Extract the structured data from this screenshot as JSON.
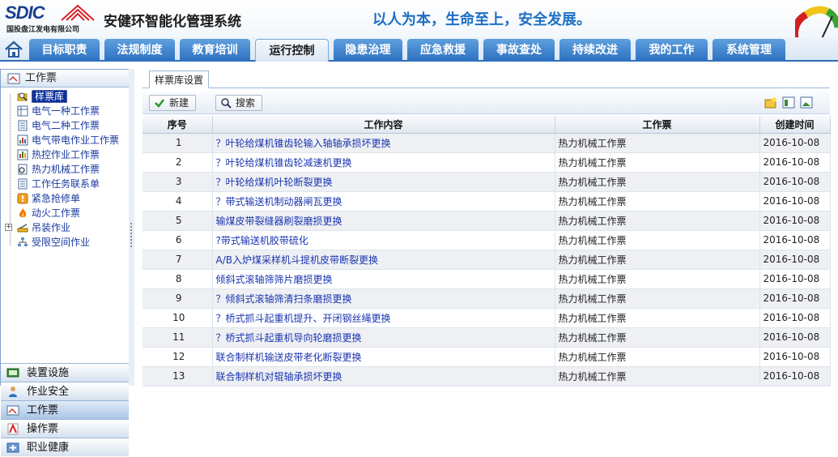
{
  "header": {
    "logo_text": "SDIC",
    "company": "国投盘江发电有限公司",
    "system_title": "安健环智能化管理系统",
    "slogan": "以人为本，生命至上，安全发展。"
  },
  "nav": {
    "tabs": [
      {
        "label": "目标职责",
        "active": false
      },
      {
        "label": "法规制度",
        "active": false
      },
      {
        "label": "教育培训",
        "active": false
      },
      {
        "label": "运行控制",
        "active": true
      },
      {
        "label": "隐患治理",
        "active": false
      },
      {
        "label": "应急救援",
        "active": false
      },
      {
        "label": "事故查处",
        "active": false
      },
      {
        "label": "持续改进",
        "active": false
      },
      {
        "label": "我的工作",
        "active": false
      },
      {
        "label": "系统管理",
        "active": false
      }
    ]
  },
  "sidebar": {
    "title": "工作票",
    "tree": [
      {
        "label": "样票库",
        "icon": "search-folder-icon",
        "selected": true
      },
      {
        "label": "电气一种工作票",
        "icon": "document-grid-icon"
      },
      {
        "label": "电气二种工作票",
        "icon": "document-list-icon"
      },
      {
        "label": "电气带电作业工作票",
        "icon": "document-chart-icon"
      },
      {
        "label": "热控作业工作票",
        "icon": "document-chart-icon"
      },
      {
        "label": "热力机械工作票",
        "icon": "gear-document-icon"
      },
      {
        "label": "工作任务联系单",
        "icon": "document-list-icon"
      },
      {
        "label": "紧急抢修单",
        "icon": "warning-icon"
      },
      {
        "label": "动火工作票",
        "icon": "fire-icon"
      },
      {
        "label": "吊装作业",
        "icon": "crane-icon",
        "expandable": true
      },
      {
        "label": "受限空间作业",
        "icon": "network-icon"
      }
    ],
    "accordion": [
      {
        "label": "装置设施",
        "icon": "device-icon",
        "active": false
      },
      {
        "label": "作业安全",
        "icon": "worker-icon",
        "active": false
      },
      {
        "label": "工作票",
        "icon": "ticket-icon",
        "active": true
      },
      {
        "label": "操作票",
        "icon": "pdf-icon",
        "active": false
      },
      {
        "label": "职业健康",
        "icon": "health-icon",
        "active": false
      }
    ]
  },
  "content": {
    "tab_label": "样票库设置",
    "toolbar": {
      "new_label": "新建",
      "search_label": "搜索"
    },
    "columns": [
      "序号",
      "工作内容",
      "工作票",
      "创建时间"
    ],
    "rows": [
      {
        "idx": "1",
        "content": "？叶轮给煤机锥齿轮输入轴轴承损坏更换",
        "ticket": "热力机械工作票",
        "date": "2016-10-08"
      },
      {
        "idx": "2",
        "content": "？叶轮给煤机锥齿轮减速机更换",
        "ticket": "热力机械工作票",
        "date": "2016-10-08"
      },
      {
        "idx": "3",
        "content": "？叶轮给煤机叶轮断裂更换",
        "ticket": "热力机械工作票",
        "date": "2016-10-08"
      },
      {
        "idx": "4",
        "content": "？带式输送机制动器闸瓦更换",
        "ticket": "热力机械工作票",
        "date": "2016-10-08"
      },
      {
        "idx": "5",
        "content": "输煤皮带裂缝器刷裂磨损更换",
        "ticket": "热力机械工作票",
        "date": "2016-10-08"
      },
      {
        "idx": "6",
        "content": "?带式输送机胶带硫化",
        "ticket": "热力机械工作票",
        "date": "2016-10-08"
      },
      {
        "idx": "7",
        "content": "A/B入炉煤采样机斗提机皮带断裂更换",
        "ticket": "热力机械工作票",
        "date": "2016-10-08"
      },
      {
        "idx": "8",
        "content": "倾斜式滚轴筛筛片磨损更换",
        "ticket": "热力机械工作票",
        "date": "2016-10-08"
      },
      {
        "idx": "9",
        "content": "？倾斜式滚轴筛清扫条磨损更换",
        "ticket": "热力机械工作票",
        "date": "2016-10-08"
      },
      {
        "idx": "10",
        "content": "？桥式抓斗起重机提升、开闭钢丝绳更换",
        "ticket": "热力机械工作票",
        "date": "2016-10-08"
      },
      {
        "idx": "11",
        "content": "？桥式抓斗起重机导向轮磨损更换",
        "ticket": "热力机械工作票",
        "date": "2016-10-08"
      },
      {
        "idx": "12",
        "content": "联合制样机输送皮带老化断裂更换",
        "ticket": "热力机械工作票",
        "date": "2016-10-08"
      },
      {
        "idx": "13",
        "content": "联合制样机对辊轴承损坏更换",
        "ticket": "热力机械工作票",
        "date": "2016-10-08"
      }
    ]
  },
  "colors": {
    "accent": "#2c6fc0",
    "link": "#1b35b0",
    "selected": "#0b2f9e"
  }
}
